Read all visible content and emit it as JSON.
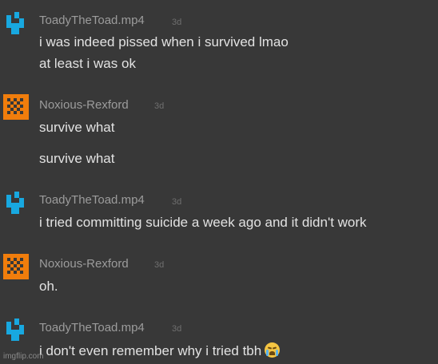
{
  "messages": [
    {
      "author": "ToadyTheToad.mp4",
      "time": "3d",
      "avatar": "blue-robot-avatar",
      "lines": [
        "i was indeed pissed when i survived lmao",
        "at least i was ok"
      ]
    },
    {
      "author": "Noxious-Rexford",
      "time": "3d",
      "avatar": "orange-checker-avatar",
      "lines": [
        "survive what",
        "survive what"
      ]
    },
    {
      "author": "ToadyTheToad.mp4",
      "time": "3d",
      "avatar": "blue-robot-avatar",
      "lines": [
        "i tried committing suicide a week ago and it didn't work"
      ]
    },
    {
      "author": "Noxious-Rexford",
      "time": "3d",
      "avatar": "orange-checker-avatar",
      "lines": [
        "oh."
      ]
    },
    {
      "author": "ToadyTheToad.mp4",
      "time": "3d",
      "avatar": "blue-robot-avatar",
      "lines": [
        "i don't even remember why i tried tbh"
      ],
      "emoji": "loudly-crying-face-emoji"
    }
  ],
  "watermark": "imgflip.com",
  "colors": {
    "background": "#383838",
    "author": "#9c9c9c",
    "timestamp": "#6f6f6f",
    "message_text": "#e2e2e2",
    "blue_avatar": "#18a8e0",
    "orange_avatar": "#f07d0c"
  }
}
